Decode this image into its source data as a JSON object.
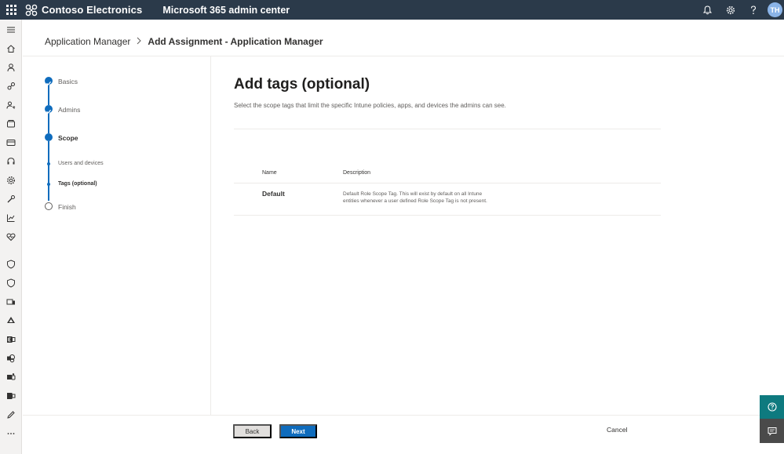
{
  "topbar": {
    "brand": "Contoso Electronics",
    "app_title": "Microsoft 365 admin center",
    "avatar_initials": "TH"
  },
  "breadcrumb": {
    "parent": "Application Manager",
    "current": "Add Assignment - Application Manager"
  },
  "stepper": {
    "steps": [
      {
        "label": "Basics",
        "status": "done"
      },
      {
        "label": "Admins",
        "status": "done"
      },
      {
        "label": "Scope",
        "status": "current"
      },
      {
        "label": "Users and devices",
        "status": "done-sub"
      },
      {
        "label": "Tags (optional)",
        "status": "current-sub"
      },
      {
        "label": "Finish",
        "status": "pending"
      }
    ]
  },
  "main": {
    "title": "Add tags (optional)",
    "description": "Select the scope tags that limit the specific Intune policies, apps, and devices the admins can see.",
    "table": {
      "columns": [
        "Name",
        "Description"
      ],
      "rows": [
        {
          "name": "Default",
          "description": "Default Role Scope Tag. This will exist by default on all Intune entities whenever a user defined Role Scope Tag is not present."
        }
      ]
    }
  },
  "footer": {
    "back_label": "Back",
    "next_label": "Next",
    "cancel_label": "Cancel"
  },
  "colors": {
    "topbar": "#2b3a4a",
    "accent": "#0f6cbd",
    "help_button": "#0e7a7f"
  }
}
